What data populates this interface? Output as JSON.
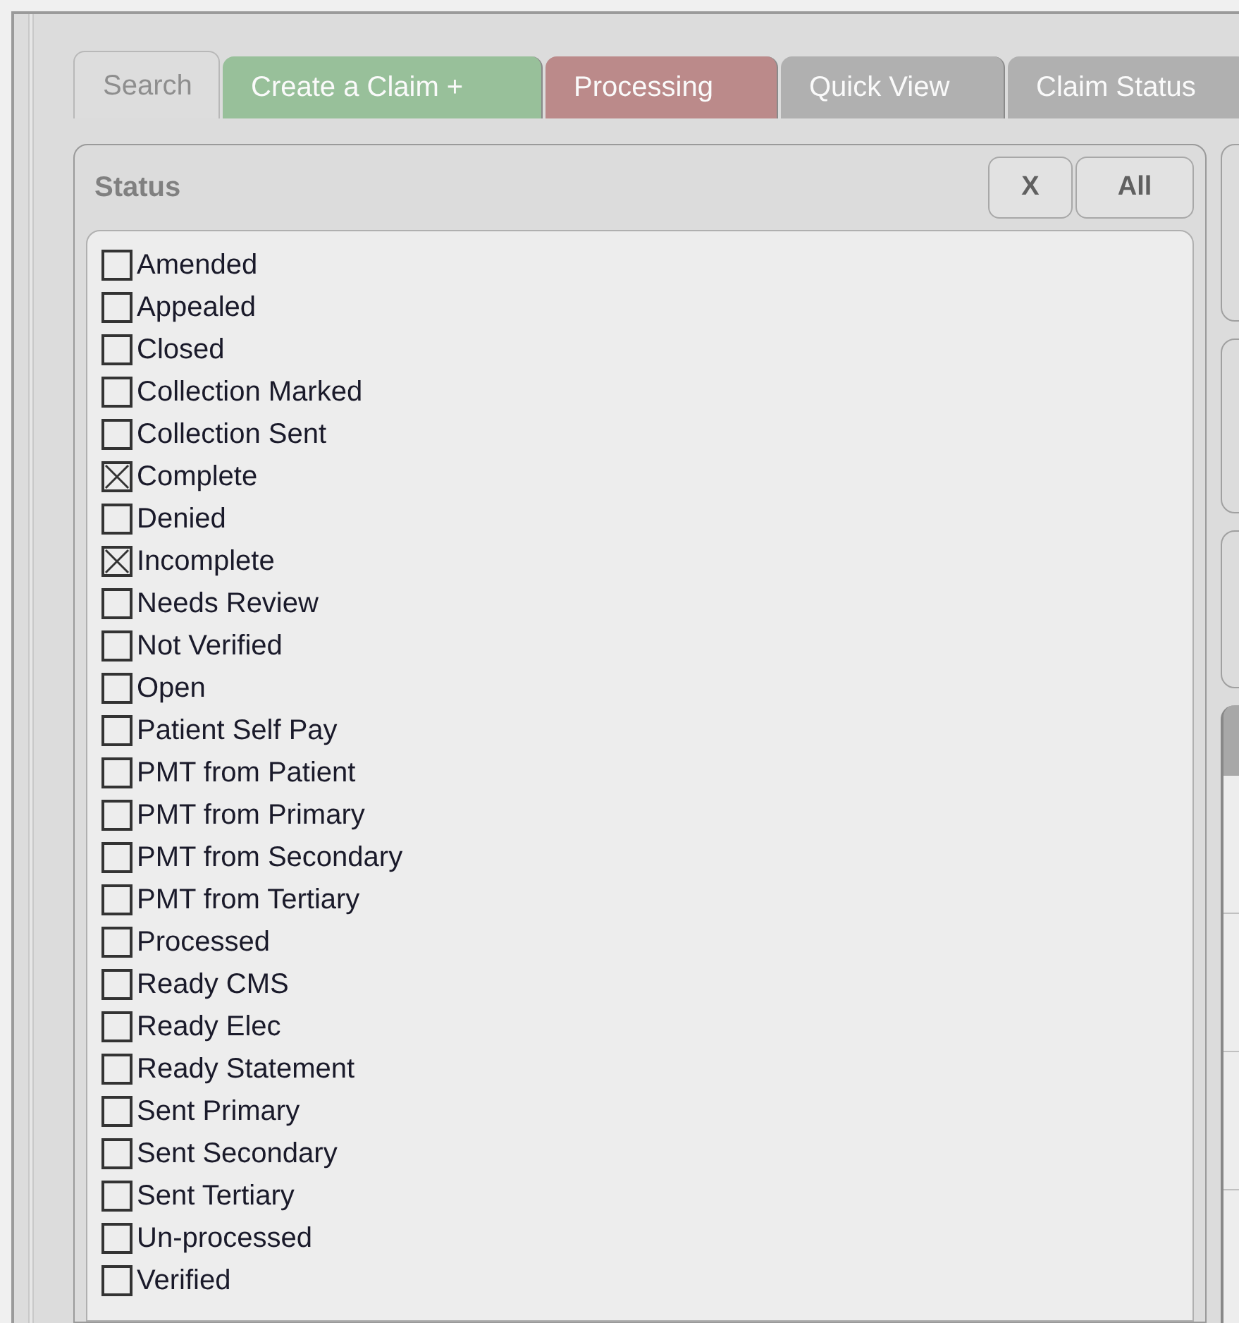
{
  "tabs": [
    {
      "label": "Search",
      "selected": true,
      "color": "#dddddd"
    },
    {
      "label": "Create a Claim +",
      "selected": false,
      "color": "#98c09a"
    },
    {
      "label": "Processing",
      "selected": false,
      "color": "#bb8a8a"
    },
    {
      "label": "Quick View",
      "selected": false,
      "color": "#b0b0b0"
    },
    {
      "label": "Claim Status",
      "selected": false,
      "color": "#b0b0b0"
    }
  ],
  "status_panel": {
    "title": "Status",
    "buttons": [
      "X",
      "All"
    ],
    "items": [
      {
        "label": "Amended",
        "checked": false
      },
      {
        "label": "Appealed",
        "checked": false
      },
      {
        "label": "Closed",
        "checked": false
      },
      {
        "label": "Collection Marked",
        "checked": false
      },
      {
        "label": "Collection Sent",
        "checked": false
      },
      {
        "label": "Complete",
        "checked": true
      },
      {
        "label": "Denied",
        "checked": false
      },
      {
        "label": "Incomplete",
        "checked": true
      },
      {
        "label": "Needs Review",
        "checked": false
      },
      {
        "label": "Not Verified",
        "checked": false
      },
      {
        "label": "Open",
        "checked": false
      },
      {
        "label": "Patient Self Pay",
        "checked": false
      },
      {
        "label": "PMT from Patient",
        "checked": false
      },
      {
        "label": "PMT from Primary",
        "checked": false
      },
      {
        "label": "PMT from Secondary",
        "checked": false
      },
      {
        "label": "PMT from Tertiary",
        "checked": false
      },
      {
        "label": "Processed",
        "checked": false
      },
      {
        "label": "Ready CMS",
        "checked": false
      },
      {
        "label": "Ready Elec",
        "checked": false
      },
      {
        "label": "Ready Statement",
        "checked": false
      },
      {
        "label": "Sent Primary",
        "checked": false
      },
      {
        "label": "Sent Secondary",
        "checked": false
      },
      {
        "label": "Sent Tertiary",
        "checked": false
      },
      {
        "label": "Un-processed",
        "checked": false
      },
      {
        "label": "Verified",
        "checked": false
      }
    ]
  }
}
